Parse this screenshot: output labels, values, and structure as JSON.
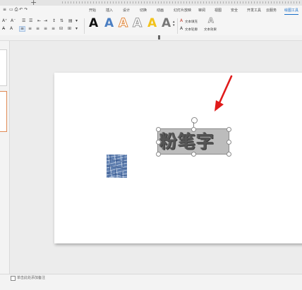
{
  "window": {
    "new_tab_symbol": "+"
  },
  "menu_tabs": [
    "开始",
    "插入",
    "设计",
    "切换",
    "动画",
    "幻灯片放映",
    "审阅",
    "视图",
    "安全",
    "开发工具",
    "云服务",
    "绘图工具"
  ],
  "active_tab": "绘图工具",
  "ribbon": {
    "text_fill_label": "文本填充",
    "text_outline_label": "文本轮廓",
    "text_effect_label": "文本效果",
    "style_glyph": "A",
    "colors": {
      "accent": "#1a6fc9"
    }
  },
  "slide": {
    "wordart_text": "粉笔字"
  },
  "notes": {
    "placeholder": "单击此处添加备注"
  }
}
